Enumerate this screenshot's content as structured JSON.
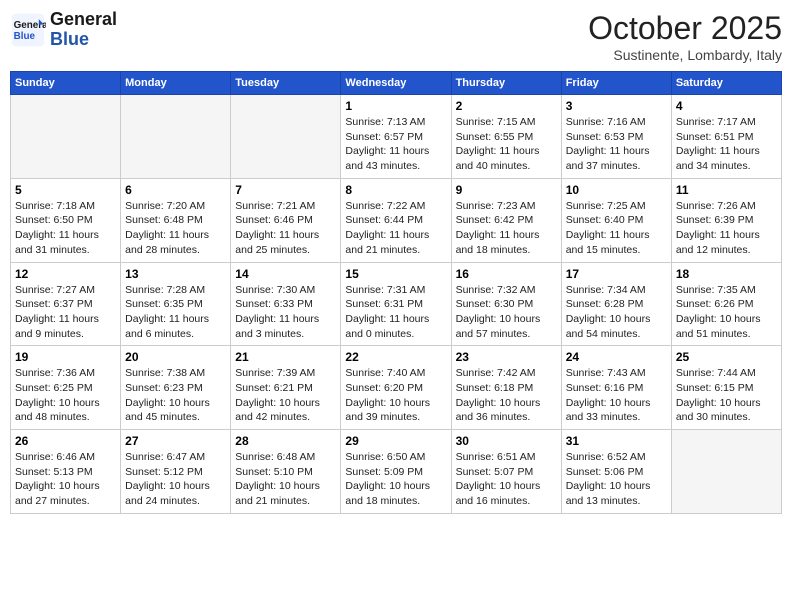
{
  "header": {
    "logo_general": "General",
    "logo_blue": "Blue",
    "month_title": "October 2025",
    "subtitle": "Sustinente, Lombardy, Italy"
  },
  "weekdays": [
    "Sunday",
    "Monday",
    "Tuesday",
    "Wednesday",
    "Thursday",
    "Friday",
    "Saturday"
  ],
  "weeks": [
    [
      {
        "day": "",
        "text": ""
      },
      {
        "day": "",
        "text": ""
      },
      {
        "day": "",
        "text": ""
      },
      {
        "day": "1",
        "text": "Sunrise: 7:13 AM\nSunset: 6:57 PM\nDaylight: 11 hours and 43 minutes."
      },
      {
        "day": "2",
        "text": "Sunrise: 7:15 AM\nSunset: 6:55 PM\nDaylight: 11 hours and 40 minutes."
      },
      {
        "day": "3",
        "text": "Sunrise: 7:16 AM\nSunset: 6:53 PM\nDaylight: 11 hours and 37 minutes."
      },
      {
        "day": "4",
        "text": "Sunrise: 7:17 AM\nSunset: 6:51 PM\nDaylight: 11 hours and 34 minutes."
      }
    ],
    [
      {
        "day": "5",
        "text": "Sunrise: 7:18 AM\nSunset: 6:50 PM\nDaylight: 11 hours and 31 minutes."
      },
      {
        "day": "6",
        "text": "Sunrise: 7:20 AM\nSunset: 6:48 PM\nDaylight: 11 hours and 28 minutes."
      },
      {
        "day": "7",
        "text": "Sunrise: 7:21 AM\nSunset: 6:46 PM\nDaylight: 11 hours and 25 minutes."
      },
      {
        "day": "8",
        "text": "Sunrise: 7:22 AM\nSunset: 6:44 PM\nDaylight: 11 hours and 21 minutes."
      },
      {
        "day": "9",
        "text": "Sunrise: 7:23 AM\nSunset: 6:42 PM\nDaylight: 11 hours and 18 minutes."
      },
      {
        "day": "10",
        "text": "Sunrise: 7:25 AM\nSunset: 6:40 PM\nDaylight: 11 hours and 15 minutes."
      },
      {
        "day": "11",
        "text": "Sunrise: 7:26 AM\nSunset: 6:39 PM\nDaylight: 11 hours and 12 minutes."
      }
    ],
    [
      {
        "day": "12",
        "text": "Sunrise: 7:27 AM\nSunset: 6:37 PM\nDaylight: 11 hours and 9 minutes."
      },
      {
        "day": "13",
        "text": "Sunrise: 7:28 AM\nSunset: 6:35 PM\nDaylight: 11 hours and 6 minutes."
      },
      {
        "day": "14",
        "text": "Sunrise: 7:30 AM\nSunset: 6:33 PM\nDaylight: 11 hours and 3 minutes."
      },
      {
        "day": "15",
        "text": "Sunrise: 7:31 AM\nSunset: 6:31 PM\nDaylight: 11 hours and 0 minutes."
      },
      {
        "day": "16",
        "text": "Sunrise: 7:32 AM\nSunset: 6:30 PM\nDaylight: 10 hours and 57 minutes."
      },
      {
        "day": "17",
        "text": "Sunrise: 7:34 AM\nSunset: 6:28 PM\nDaylight: 10 hours and 54 minutes."
      },
      {
        "day": "18",
        "text": "Sunrise: 7:35 AM\nSunset: 6:26 PM\nDaylight: 10 hours and 51 minutes."
      }
    ],
    [
      {
        "day": "19",
        "text": "Sunrise: 7:36 AM\nSunset: 6:25 PM\nDaylight: 10 hours and 48 minutes."
      },
      {
        "day": "20",
        "text": "Sunrise: 7:38 AM\nSunset: 6:23 PM\nDaylight: 10 hours and 45 minutes."
      },
      {
        "day": "21",
        "text": "Sunrise: 7:39 AM\nSunset: 6:21 PM\nDaylight: 10 hours and 42 minutes."
      },
      {
        "day": "22",
        "text": "Sunrise: 7:40 AM\nSunset: 6:20 PM\nDaylight: 10 hours and 39 minutes."
      },
      {
        "day": "23",
        "text": "Sunrise: 7:42 AM\nSunset: 6:18 PM\nDaylight: 10 hours and 36 minutes."
      },
      {
        "day": "24",
        "text": "Sunrise: 7:43 AM\nSunset: 6:16 PM\nDaylight: 10 hours and 33 minutes."
      },
      {
        "day": "25",
        "text": "Sunrise: 7:44 AM\nSunset: 6:15 PM\nDaylight: 10 hours and 30 minutes."
      }
    ],
    [
      {
        "day": "26",
        "text": "Sunrise: 6:46 AM\nSunset: 5:13 PM\nDaylight: 10 hours and 27 minutes."
      },
      {
        "day": "27",
        "text": "Sunrise: 6:47 AM\nSunset: 5:12 PM\nDaylight: 10 hours and 24 minutes."
      },
      {
        "day": "28",
        "text": "Sunrise: 6:48 AM\nSunset: 5:10 PM\nDaylight: 10 hours and 21 minutes."
      },
      {
        "day": "29",
        "text": "Sunrise: 6:50 AM\nSunset: 5:09 PM\nDaylight: 10 hours and 18 minutes."
      },
      {
        "day": "30",
        "text": "Sunrise: 6:51 AM\nSunset: 5:07 PM\nDaylight: 10 hours and 16 minutes."
      },
      {
        "day": "31",
        "text": "Sunrise: 6:52 AM\nSunset: 5:06 PM\nDaylight: 10 hours and 13 minutes."
      },
      {
        "day": "",
        "text": ""
      }
    ]
  ]
}
